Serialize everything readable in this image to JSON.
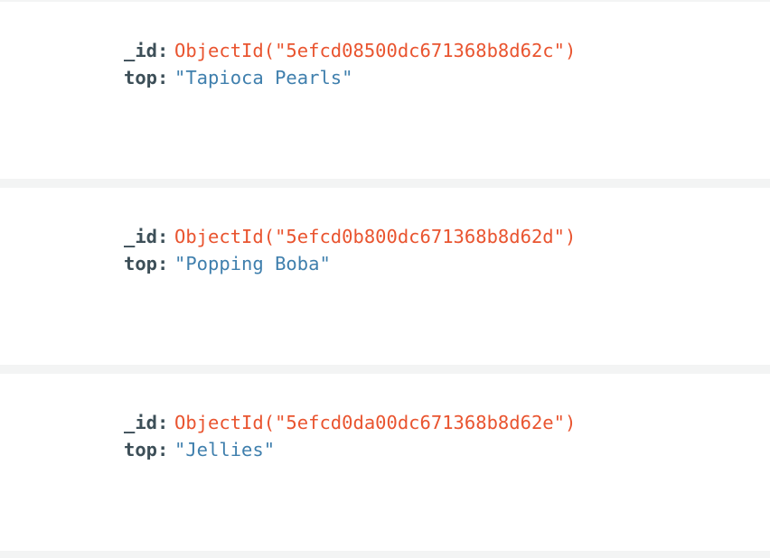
{
  "documents": [
    {
      "id_key": "_id:",
      "id_value": "ObjectId(\"5efcd08500dc671368b8d62c\")",
      "top_key": "top:",
      "top_value": "\"Tapioca Pearls\""
    },
    {
      "id_key": "_id:",
      "id_value": "ObjectId(\"5efcd0b800dc671368b8d62d\")",
      "top_key": "top:",
      "top_value": "\"Popping Boba\""
    },
    {
      "id_key": "_id:",
      "id_value": "ObjectId(\"5efcd0da00dc671368b8d62e\")",
      "top_key": "top:",
      "top_value": "\"Jellies\""
    }
  ],
  "colors": {
    "key": "#3d4f58",
    "object_id": "#e9542f",
    "string": "#3f7fad",
    "card_bg": "#ffffff",
    "separator": "#f3f4f4"
  }
}
